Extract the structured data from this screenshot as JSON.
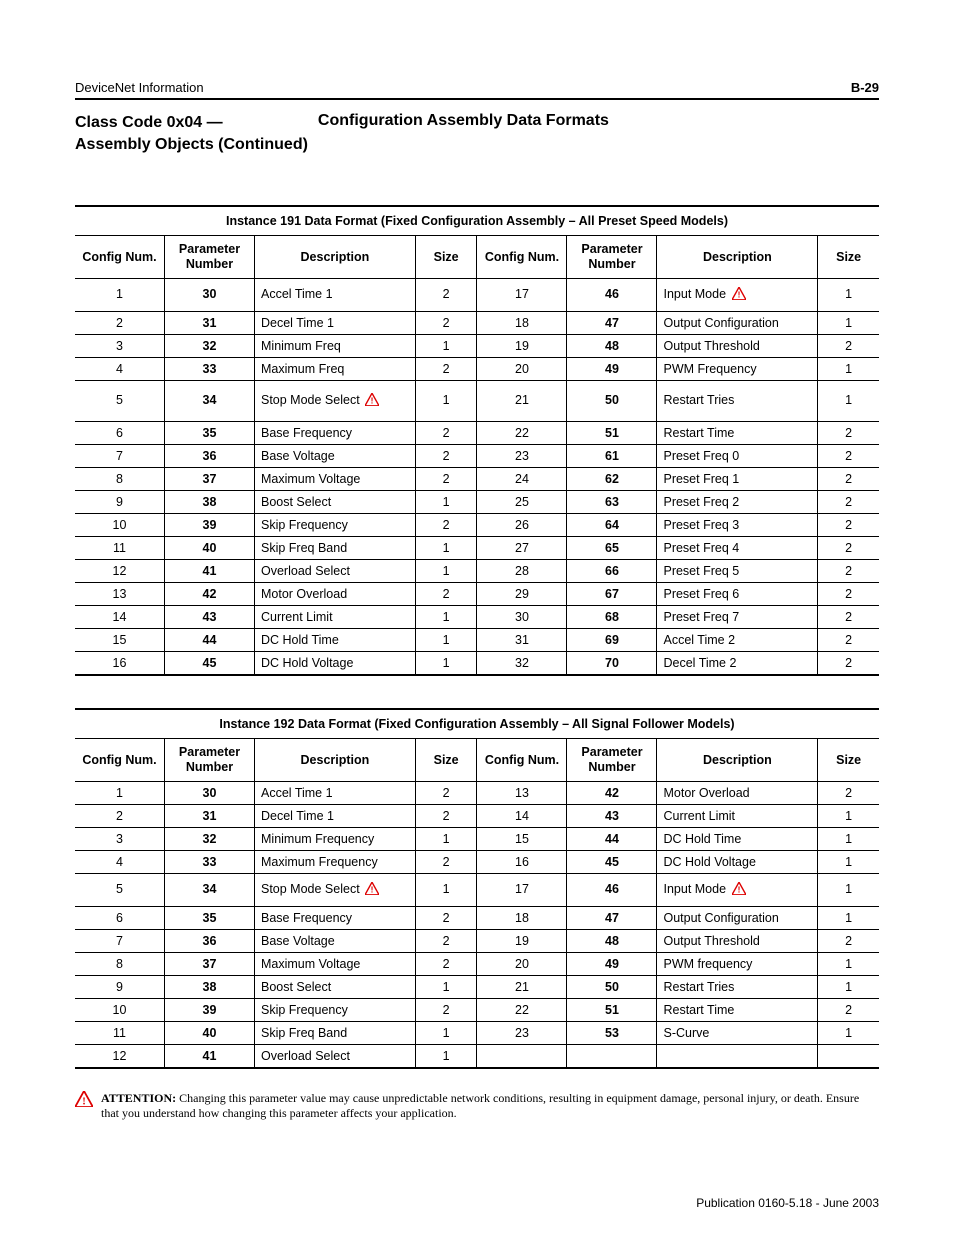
{
  "header": {
    "left": "DeviceNet Information",
    "right": "B-29"
  },
  "titles": {
    "left_line1": "Class Code 0x04 —",
    "left_line2": "Assembly Objects (Continued)",
    "right": "Configuration Assembly Data Formats"
  },
  "table_headers": {
    "c1": "Config Num.",
    "c2": "Parameter Number",
    "c3": "Description",
    "c4": "Size"
  },
  "table1": {
    "caption": "Instance 191 Data Format (Fixed Configuration Assembly – All Preset Speed Models)",
    "rows": [
      {
        "l": {
          "cfg": "1",
          "par": "30",
          "desc": "Accel Time 1",
          "size": "2",
          "tall": true
        },
        "r": {
          "cfg": "17",
          "par": "46",
          "desc": "Input Mode",
          "warn": true,
          "size": "1",
          "tall": true
        }
      },
      {
        "l": {
          "cfg": "2",
          "par": "31",
          "desc": "Decel Time 1",
          "size": "2"
        },
        "r": {
          "cfg": "18",
          "par": "47",
          "desc": "Output Configuration",
          "size": "1"
        }
      },
      {
        "l": {
          "cfg": "3",
          "par": "32",
          "desc": "Minimum Freq",
          "size": "1"
        },
        "r": {
          "cfg": "19",
          "par": "48",
          "desc": "Output Threshold",
          "size": "2"
        }
      },
      {
        "l": {
          "cfg": "4",
          "par": "33",
          "desc": "Maximum Freq",
          "size": "2"
        },
        "r": {
          "cfg": "20",
          "par": "49",
          "desc": "PWM Frequency",
          "size": "1"
        }
      },
      {
        "l": {
          "cfg": "5",
          "par": "34",
          "desc": "Stop Mode Select",
          "warn": true,
          "size": "1",
          "tallxt": true
        },
        "r": {
          "cfg": "21",
          "par": "50",
          "desc": "Restart Tries",
          "size": "1",
          "tallxt": true
        }
      },
      {
        "l": {
          "cfg": "6",
          "par": "35",
          "desc": "Base Frequency",
          "size": "2"
        },
        "r": {
          "cfg": "22",
          "par": "51",
          "desc": "Restart Time",
          "size": "2"
        }
      },
      {
        "l": {
          "cfg": "7",
          "par": "36",
          "desc": "Base Voltage",
          "size": "2"
        },
        "r": {
          "cfg": "23",
          "par": "61",
          "desc": "Preset Freq 0",
          "size": "2"
        }
      },
      {
        "l": {
          "cfg": "8",
          "par": "37",
          "desc": "Maximum Voltage",
          "size": "2"
        },
        "r": {
          "cfg": "24",
          "par": "62",
          "desc": "Preset Freq 1",
          "size": "2"
        }
      },
      {
        "l": {
          "cfg": "9",
          "par": "38",
          "desc": "Boost Select",
          "size": "1"
        },
        "r": {
          "cfg": "25",
          "par": "63",
          "desc": "Preset Freq 2",
          "size": "2"
        }
      },
      {
        "l": {
          "cfg": "10",
          "par": "39",
          "desc": "Skip Frequency",
          "size": "2"
        },
        "r": {
          "cfg": "26",
          "par": "64",
          "desc": "Preset Freq 3",
          "size": "2"
        }
      },
      {
        "l": {
          "cfg": "11",
          "par": "40",
          "desc": "Skip Freq Band",
          "size": "1"
        },
        "r": {
          "cfg": "27",
          "par": "65",
          "desc": "Preset Freq 4",
          "size": "2"
        }
      },
      {
        "l": {
          "cfg": "12",
          "par": "41",
          "desc": "Overload Select",
          "size": "1"
        },
        "r": {
          "cfg": "28",
          "par": "66",
          "desc": "Preset Freq 5",
          "size": "2"
        }
      },
      {
        "l": {
          "cfg": "13",
          "par": "42",
          "desc": "Motor Overload",
          "size": "2"
        },
        "r": {
          "cfg": "29",
          "par": "67",
          "desc": "Preset Freq 6",
          "size": "2"
        }
      },
      {
        "l": {
          "cfg": "14",
          "par": "43",
          "desc": "Current Limit",
          "size": "1"
        },
        "r": {
          "cfg": "30",
          "par": "68",
          "desc": "Preset Freq 7",
          "size": "2"
        }
      },
      {
        "l": {
          "cfg": "15",
          "par": "44",
          "desc": "DC Hold Time",
          "size": "1"
        },
        "r": {
          "cfg": "31",
          "par": "69",
          "desc": "Accel Time 2",
          "size": "2"
        }
      },
      {
        "l": {
          "cfg": "16",
          "par": "45",
          "desc": "DC Hold Voltage",
          "size": "1"
        },
        "r": {
          "cfg": "32",
          "par": "70",
          "desc": "Decel Time 2",
          "size": "2"
        }
      }
    ]
  },
  "table2": {
    "caption": "Instance 192 Data Format (Fixed Configuration Assembly – All Signal Follower Models)",
    "rows": [
      {
        "l": {
          "cfg": "1",
          "par": "30",
          "desc": "Accel Time 1",
          "size": "2"
        },
        "r": {
          "cfg": "13",
          "par": "42",
          "desc": "Motor Overload",
          "size": "2"
        }
      },
      {
        "l": {
          "cfg": "2",
          "par": "31",
          "desc": "Decel Time 1",
          "size": "2"
        },
        "r": {
          "cfg": "14",
          "par": "43",
          "desc": "Current Limit",
          "size": "1"
        }
      },
      {
        "l": {
          "cfg": "3",
          "par": "32",
          "desc": "Minimum Frequency",
          "size": "1"
        },
        "r": {
          "cfg": "15",
          "par": "44",
          "desc": "DC Hold Time",
          "size": "1"
        }
      },
      {
        "l": {
          "cfg": "4",
          "par": "33",
          "desc": "Maximum Frequency",
          "size": "2"
        },
        "r": {
          "cfg": "16",
          "par": "45",
          "desc": "DC Hold Voltage",
          "size": "1"
        }
      },
      {
        "l": {
          "cfg": "5",
          "par": "34",
          "desc": "Stop Mode Select",
          "warn": true,
          "size": "1",
          "tall": true
        },
        "r": {
          "cfg": "17",
          "par": "46",
          "desc": "Input Mode",
          "warn": true,
          "size": "1",
          "tall": true
        }
      },
      {
        "l": {
          "cfg": "6",
          "par": "35",
          "desc": "Base Frequency",
          "size": "2"
        },
        "r": {
          "cfg": "18",
          "par": "47",
          "desc": "Output Configuration",
          "size": "1"
        }
      },
      {
        "l": {
          "cfg": "7",
          "par": "36",
          "desc": "Base Voltage",
          "size": "2"
        },
        "r": {
          "cfg": "19",
          "par": "48",
          "desc": "Output Threshold",
          "size": "2"
        }
      },
      {
        "l": {
          "cfg": "8",
          "par": "37",
          "desc": "Maximum Voltage",
          "size": "2"
        },
        "r": {
          "cfg": "20",
          "par": "49",
          "desc": "PWM frequency",
          "size": "1"
        }
      },
      {
        "l": {
          "cfg": "9",
          "par": "38",
          "desc": "Boost Select",
          "size": "1"
        },
        "r": {
          "cfg": "21",
          "par": "50",
          "desc": "Restart Tries",
          "size": "1"
        }
      },
      {
        "l": {
          "cfg": "10",
          "par": "39",
          "desc": "Skip Frequency",
          "size": "2"
        },
        "r": {
          "cfg": "22",
          "par": "51",
          "desc": "Restart Time",
          "size": "2"
        }
      },
      {
        "l": {
          "cfg": "11",
          "par": "40",
          "desc": "Skip Freq Band",
          "size": "1"
        },
        "r": {
          "cfg": "23",
          "par": "53",
          "desc": "S-Curve",
          "size": "1"
        }
      },
      {
        "l": {
          "cfg": "12",
          "par": "41",
          "desc": "Overload Select",
          "size": "1"
        },
        "r": {
          "cfg": "",
          "par": "",
          "desc": "",
          "size": ""
        }
      }
    ]
  },
  "attention": {
    "label": "ATTENTION:",
    "text": " Changing this parameter value may cause unpredictable network conditions, resulting in equipment damage, personal injury, or death. Ensure that you understand how changing this parameter affects your application."
  },
  "publication": "Publication 0160-5.18 - June 2003"
}
